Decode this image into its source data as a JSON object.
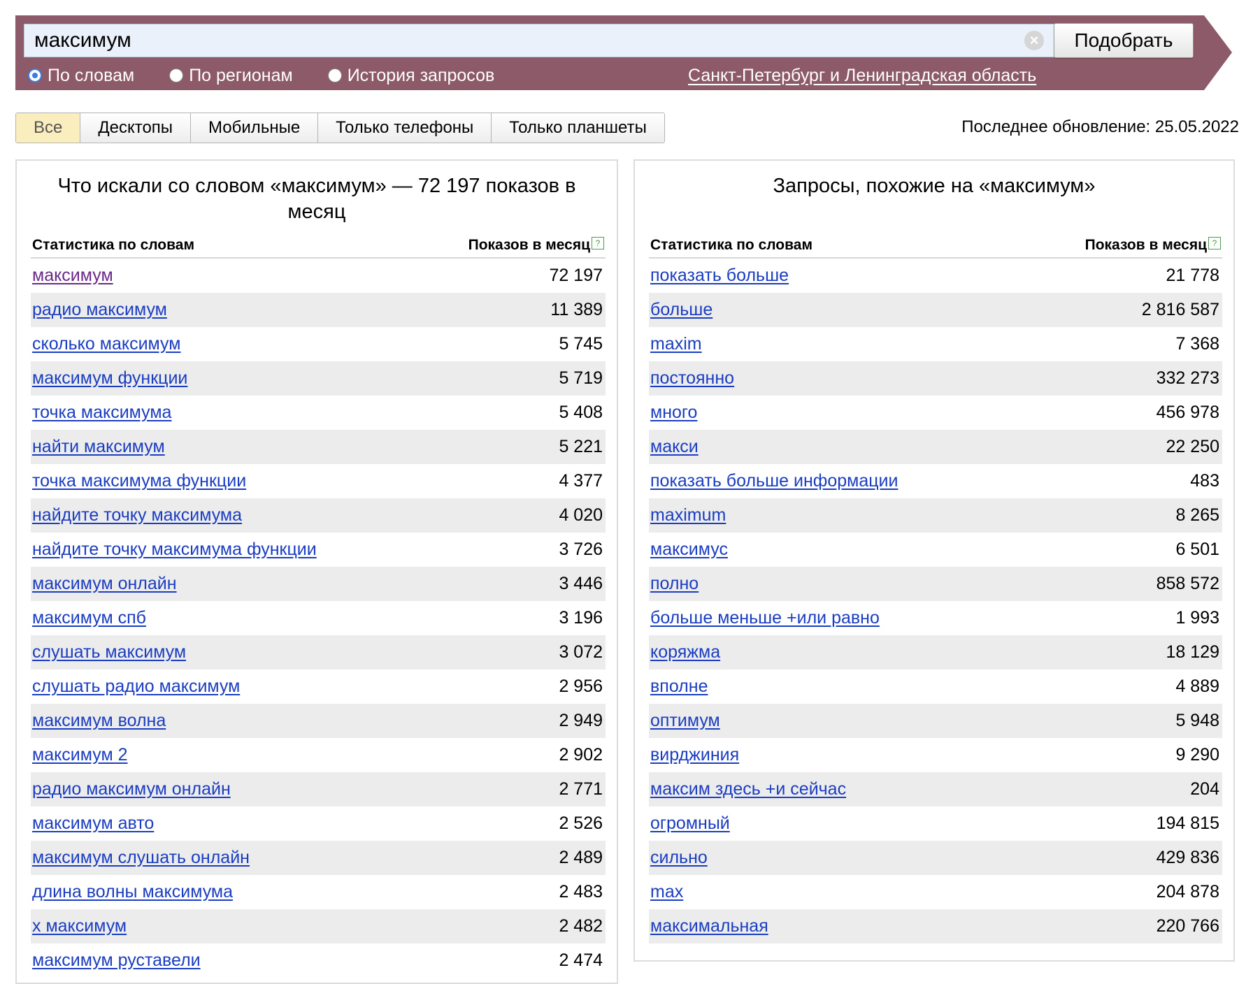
{
  "search": {
    "query": "максимум",
    "submit_label": "Подобрать",
    "clear_glyph": "×",
    "modes": [
      {
        "label": "По словам",
        "checked": true
      },
      {
        "label": "По регионам",
        "checked": false
      },
      {
        "label": "История запросов",
        "checked": false
      }
    ],
    "region": "Санкт-Петербург и Ленинградская область",
    "bar_color": "#8c5a69"
  },
  "device_tabs": [
    "Все",
    "Десктопы",
    "Мобильные",
    "Только телефоны",
    "Только планшеты"
  ],
  "active_tab": "Все",
  "last_update": "Последнее обновление: 25.05.2022",
  "left_panel": {
    "title": "Что искали со словом «максимум» — 72 197 показов в месяц",
    "col_words": "Статистика по словам",
    "col_shows": "Показов в месяц",
    "rows": [
      {
        "phrase": "максимум",
        "count": "72 197"
      },
      {
        "phrase": "радио максимум",
        "count": "11 389"
      },
      {
        "phrase": "сколько максимум",
        "count": "5 745"
      },
      {
        "phrase": "максимум функции",
        "count": "5 719"
      },
      {
        "phrase": "точка максимума",
        "count": "5 408"
      },
      {
        "phrase": "найти максимум",
        "count": "5 221"
      },
      {
        "phrase": "точка максимума функции",
        "count": "4 377"
      },
      {
        "phrase": "найдите точку максимума",
        "count": "4 020"
      },
      {
        "phrase": "найдите точку максимума функции",
        "count": "3 726"
      },
      {
        "phrase": "максимум онлайн",
        "count": "3 446"
      },
      {
        "phrase": "максимум спб",
        "count": "3 196"
      },
      {
        "phrase": "слушать максимум",
        "count": "3 072"
      },
      {
        "phrase": "слушать радио максимум",
        "count": "2 956"
      },
      {
        "phrase": "максимум волна",
        "count": "2 949"
      },
      {
        "phrase": "максимум 2",
        "count": "2 902"
      },
      {
        "phrase": "радио максимум онлайн",
        "count": "2 771"
      },
      {
        "phrase": "максимум авто",
        "count": "2 526"
      },
      {
        "phrase": "максимум слушать онлайн",
        "count": "2 489"
      },
      {
        "phrase": "длина волны максимума",
        "count": "2 483"
      },
      {
        "phrase": "х максимум",
        "count": "2 482"
      },
      {
        "phrase": "максимум руставели",
        "count": "2 474"
      }
    ]
  },
  "right_panel": {
    "title": "Запросы, похожие на «максимум»",
    "col_words": "Статистика по словам",
    "col_shows": "Показов в месяц",
    "rows": [
      {
        "phrase": "показать больше",
        "count": "21 778"
      },
      {
        "phrase": "больше",
        "count": "2 816 587"
      },
      {
        "phrase": "maxim",
        "count": "7 368"
      },
      {
        "phrase": "постоянно",
        "count": "332 273"
      },
      {
        "phrase": "много",
        "count": "456 978"
      },
      {
        "phrase": "макси",
        "count": "22 250"
      },
      {
        "phrase": "показать больше информации",
        "count": "483"
      },
      {
        "phrase": "maximum",
        "count": "8 265"
      },
      {
        "phrase": "максимус",
        "count": "6 501"
      },
      {
        "phrase": "полно",
        "count": "858 572"
      },
      {
        "phrase": "больше меньше +или равно",
        "count": "1 993"
      },
      {
        "phrase": "коряжма",
        "count": "18 129"
      },
      {
        "phrase": "вполне",
        "count": "4 889"
      },
      {
        "phrase": "оптимум",
        "count": "5 948"
      },
      {
        "phrase": "вирджиния",
        "count": "9 290"
      },
      {
        "phrase": "максим здесь +и сейчас",
        "count": "204"
      },
      {
        "phrase": "огромный",
        "count": "194 815"
      },
      {
        "phrase": "сильно",
        "count": "429 836"
      },
      {
        "phrase": "max",
        "count": "204 878"
      },
      {
        "phrase": "максимальная",
        "count": "220 766"
      }
    ]
  }
}
